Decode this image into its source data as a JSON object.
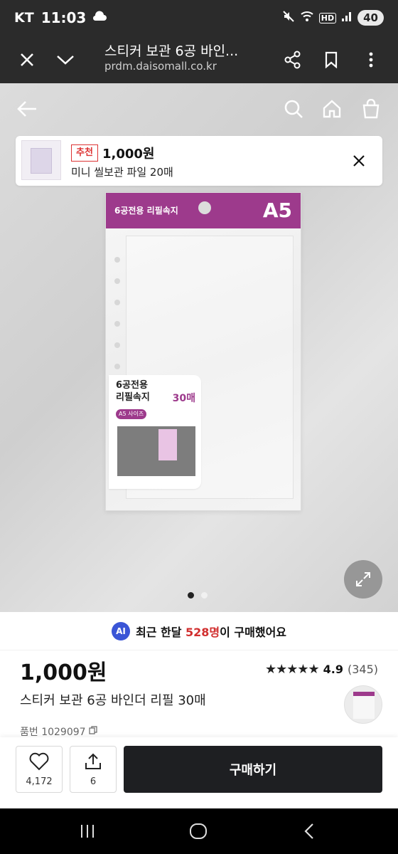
{
  "status_bar": {
    "carrier": "KT",
    "time": "11:03",
    "battery": "40",
    "network": "HD"
  },
  "browser": {
    "title": "스티커 보관 6공 바인...",
    "url": "prdm.daisomall.co.kr"
  },
  "recommendation": {
    "badge": "추천",
    "price": "1,000원",
    "name": "미니 씰보관 파일 20매"
  },
  "package": {
    "header_label": "6공전용 리필속지",
    "size": "A5",
    "label_title_line1": "6공전용",
    "label_title_line2": "리필속지",
    "label_count": "30매",
    "label_tag": "A5 사이즈"
  },
  "gallery": {
    "total": 2,
    "active_index": 0
  },
  "ai_notice": {
    "badge": "AI",
    "prefix": "최근 한달",
    "count": "528명",
    "suffix": "이 구매했어요"
  },
  "product": {
    "price": "1,000원",
    "rating": "4.9",
    "review_count": "(345)",
    "stars": "★★★★★",
    "name": "스티커 보관 6공 바인더 리필 30매",
    "code": "품번 1029097"
  },
  "actions": {
    "like_count": "4,172",
    "share_count": "6",
    "buy_label": "구매하기"
  }
}
